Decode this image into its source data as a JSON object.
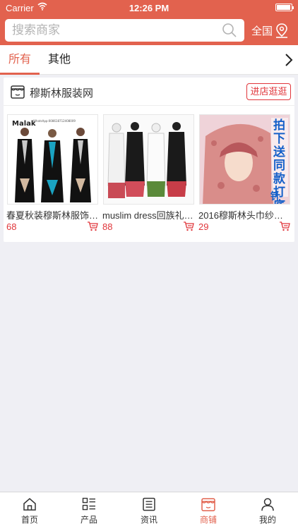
{
  "status_bar": {
    "carrier": "Carrier",
    "time": "12:26 PM",
    "battery_level": 0.95
  },
  "search": {
    "placeholder": "搜索商家",
    "region": "全国"
  },
  "tabs": [
    {
      "label": "所有",
      "active": true
    },
    {
      "label": "其他",
      "active": false
    }
  ],
  "shop": {
    "name": "穆斯林服装网",
    "visit_label": "进店逛逛"
  },
  "products": [
    {
      "name": "春夏秋装穆斯林服饰…",
      "price": "68",
      "image_text": "Malak",
      "image_subtext": "WhatsApp:008618712408009"
    },
    {
      "name": "muslim dress回族礼…",
      "price": "88"
    },
    {
      "name": "2016穆斯林头巾纱巾…",
      "price": "29",
      "image_banner": "拍下送同款打底帽",
      "image_badge": "针"
    }
  ],
  "tabbar": [
    {
      "label": "首页",
      "icon": "home-icon",
      "active": false
    },
    {
      "label": "产品",
      "icon": "product-list-icon",
      "active": false
    },
    {
      "label": "资讯",
      "icon": "news-icon",
      "active": false
    },
    {
      "label": "商铺",
      "icon": "store-icon",
      "active": true
    },
    {
      "label": "我的",
      "icon": "profile-icon",
      "active": false
    }
  ],
  "colors": {
    "brand": "#e2624e",
    "price": "#e0353a",
    "background": "#efeff4"
  }
}
